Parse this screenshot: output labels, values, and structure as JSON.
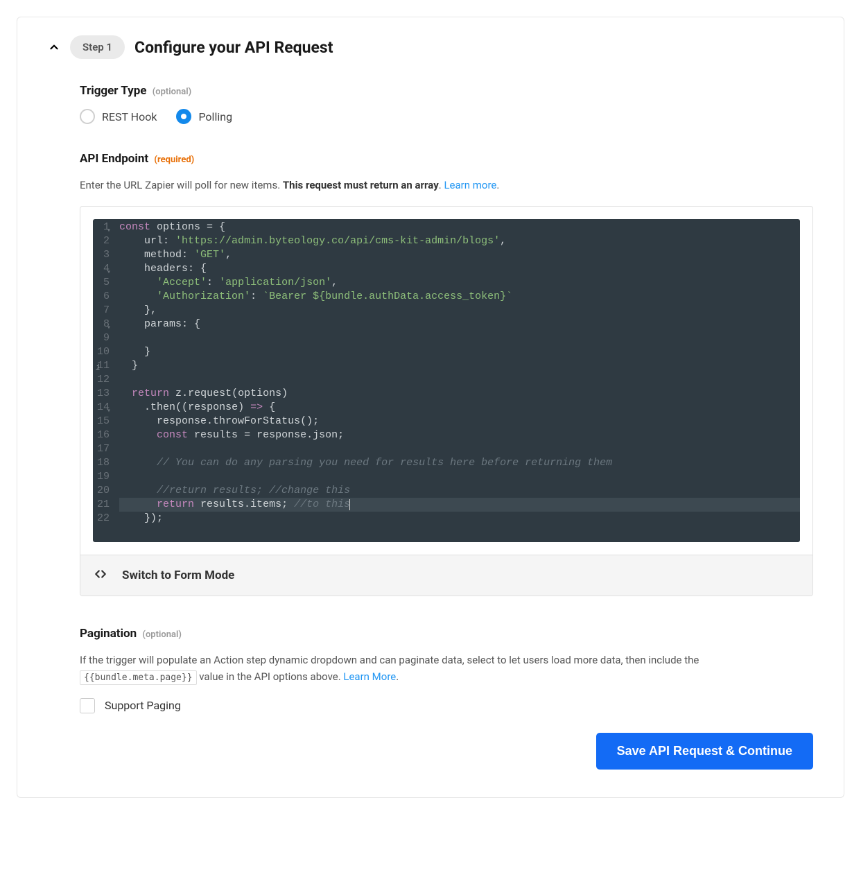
{
  "header": {
    "step_badge": "Step 1",
    "title": "Configure your API Request"
  },
  "trigger_type": {
    "label": "Trigger Type",
    "optional": "(optional)",
    "options": {
      "rest_hook": "REST Hook",
      "polling": "Polling"
    },
    "selected": "polling"
  },
  "api_endpoint": {
    "label": "API Endpoint",
    "required": "(required)",
    "desc_1": "Enter the URL Zapier will poll for new items. ",
    "desc_bold": "This request must return an array",
    "desc_2": ". ",
    "learn": "Learn more",
    "desc_3": "."
  },
  "code": {
    "line_start": 1,
    "lines": [
      {
        "n": "1",
        "fold": true,
        "seg": [
          [
            "kw",
            "const"
          ],
          [
            "prop",
            " options "
          ],
          [
            "punc",
            "= {"
          ]
        ]
      },
      {
        "n": "2",
        "seg": [
          [
            "prop",
            "    url"
          ],
          [
            "punc",
            ": "
          ],
          [
            "str",
            "'https://admin.byteology.co/api/cms-kit-admin/blogs'"
          ],
          [
            "punc",
            ","
          ]
        ]
      },
      {
        "n": "3",
        "seg": [
          [
            "prop",
            "    method"
          ],
          [
            "punc",
            ": "
          ],
          [
            "str",
            "'GET'"
          ],
          [
            "punc",
            ","
          ]
        ]
      },
      {
        "n": "4",
        "fold": true,
        "seg": [
          [
            "prop",
            "    headers"
          ],
          [
            "punc",
            ": {"
          ]
        ]
      },
      {
        "n": "5",
        "seg": [
          [
            "punc",
            "      "
          ],
          [
            "str",
            "'Accept'"
          ],
          [
            "punc",
            ": "
          ],
          [
            "str",
            "'application/json'"
          ],
          [
            "punc",
            ","
          ]
        ]
      },
      {
        "n": "6",
        "seg": [
          [
            "punc",
            "      "
          ],
          [
            "str",
            "'Authorization'"
          ],
          [
            "punc",
            ": "
          ],
          [
            "tmpl",
            "`Bearer ${bundle.authData.access_token}`"
          ]
        ]
      },
      {
        "n": "7",
        "seg": [
          [
            "punc",
            "    },"
          ]
        ]
      },
      {
        "n": "8",
        "fold": true,
        "seg": [
          [
            "prop",
            "    params"
          ],
          [
            "punc",
            ": {"
          ]
        ]
      },
      {
        "n": "9",
        "seg": [
          [
            "prop",
            ""
          ]
        ]
      },
      {
        "n": "10",
        "seg": [
          [
            "punc",
            "    }"
          ]
        ]
      },
      {
        "n": "11",
        "lint": true,
        "seg": [
          [
            "punc",
            "  }"
          ]
        ]
      },
      {
        "n": "12",
        "seg": [
          [
            "prop",
            ""
          ]
        ]
      },
      {
        "n": "13",
        "seg": [
          [
            "punc",
            "  "
          ],
          [
            "kw",
            "return"
          ],
          [
            "prop",
            " z"
          ],
          [
            "punc",
            "."
          ],
          [
            "fn",
            "request"
          ],
          [
            "punc",
            "(options)"
          ]
        ]
      },
      {
        "n": "14",
        "fold": true,
        "seg": [
          [
            "punc",
            "    ."
          ],
          [
            "fn",
            "then"
          ],
          [
            "punc",
            "(("
          ],
          [
            "prop",
            "response"
          ],
          [
            "punc",
            ") "
          ],
          [
            "kw",
            "=>"
          ],
          [
            "punc",
            " {"
          ]
        ]
      },
      {
        "n": "15",
        "seg": [
          [
            "punc",
            "      response."
          ],
          [
            "fn",
            "throwForStatus"
          ],
          [
            "punc",
            "();"
          ]
        ]
      },
      {
        "n": "16",
        "seg": [
          [
            "punc",
            "      "
          ],
          [
            "kw",
            "const"
          ],
          [
            "prop",
            " results "
          ],
          [
            "punc",
            "= response.json;"
          ]
        ]
      },
      {
        "n": "17",
        "seg": [
          [
            "prop",
            ""
          ]
        ]
      },
      {
        "n": "18",
        "seg": [
          [
            "punc",
            "      "
          ],
          [
            "cmt",
            "// You can do any parsing you need for results here before returning them"
          ]
        ]
      },
      {
        "n": "19",
        "seg": [
          [
            "prop",
            ""
          ]
        ]
      },
      {
        "n": "20",
        "seg": [
          [
            "punc",
            "      "
          ],
          [
            "cmt",
            "//return results; //change this"
          ]
        ]
      },
      {
        "n": "21",
        "sel": true,
        "caret": true,
        "seg": [
          [
            "punc",
            "      "
          ],
          [
            "kw",
            "return"
          ],
          [
            "prop",
            " results.items"
          ],
          [
            "punc",
            "; "
          ],
          [
            "cmt",
            "//to this"
          ]
        ]
      },
      {
        "n": "22",
        "seg": [
          [
            "punc",
            "    });"
          ]
        ]
      }
    ]
  },
  "switch_mode": {
    "label": "Switch to Form Mode"
  },
  "pagination": {
    "label": "Pagination",
    "optional": "(optional)",
    "desc_1": "If the trigger will populate an Action step dynamic dropdown and can paginate data, select to let users load more data, then include the ",
    "code": "{{bundle.meta.page}}",
    "desc_2": " value in the API options above. ",
    "learn": "Learn More",
    "desc_3": ".",
    "support_label": "Support Paging"
  },
  "footer": {
    "save_button": "Save API Request & Continue"
  }
}
